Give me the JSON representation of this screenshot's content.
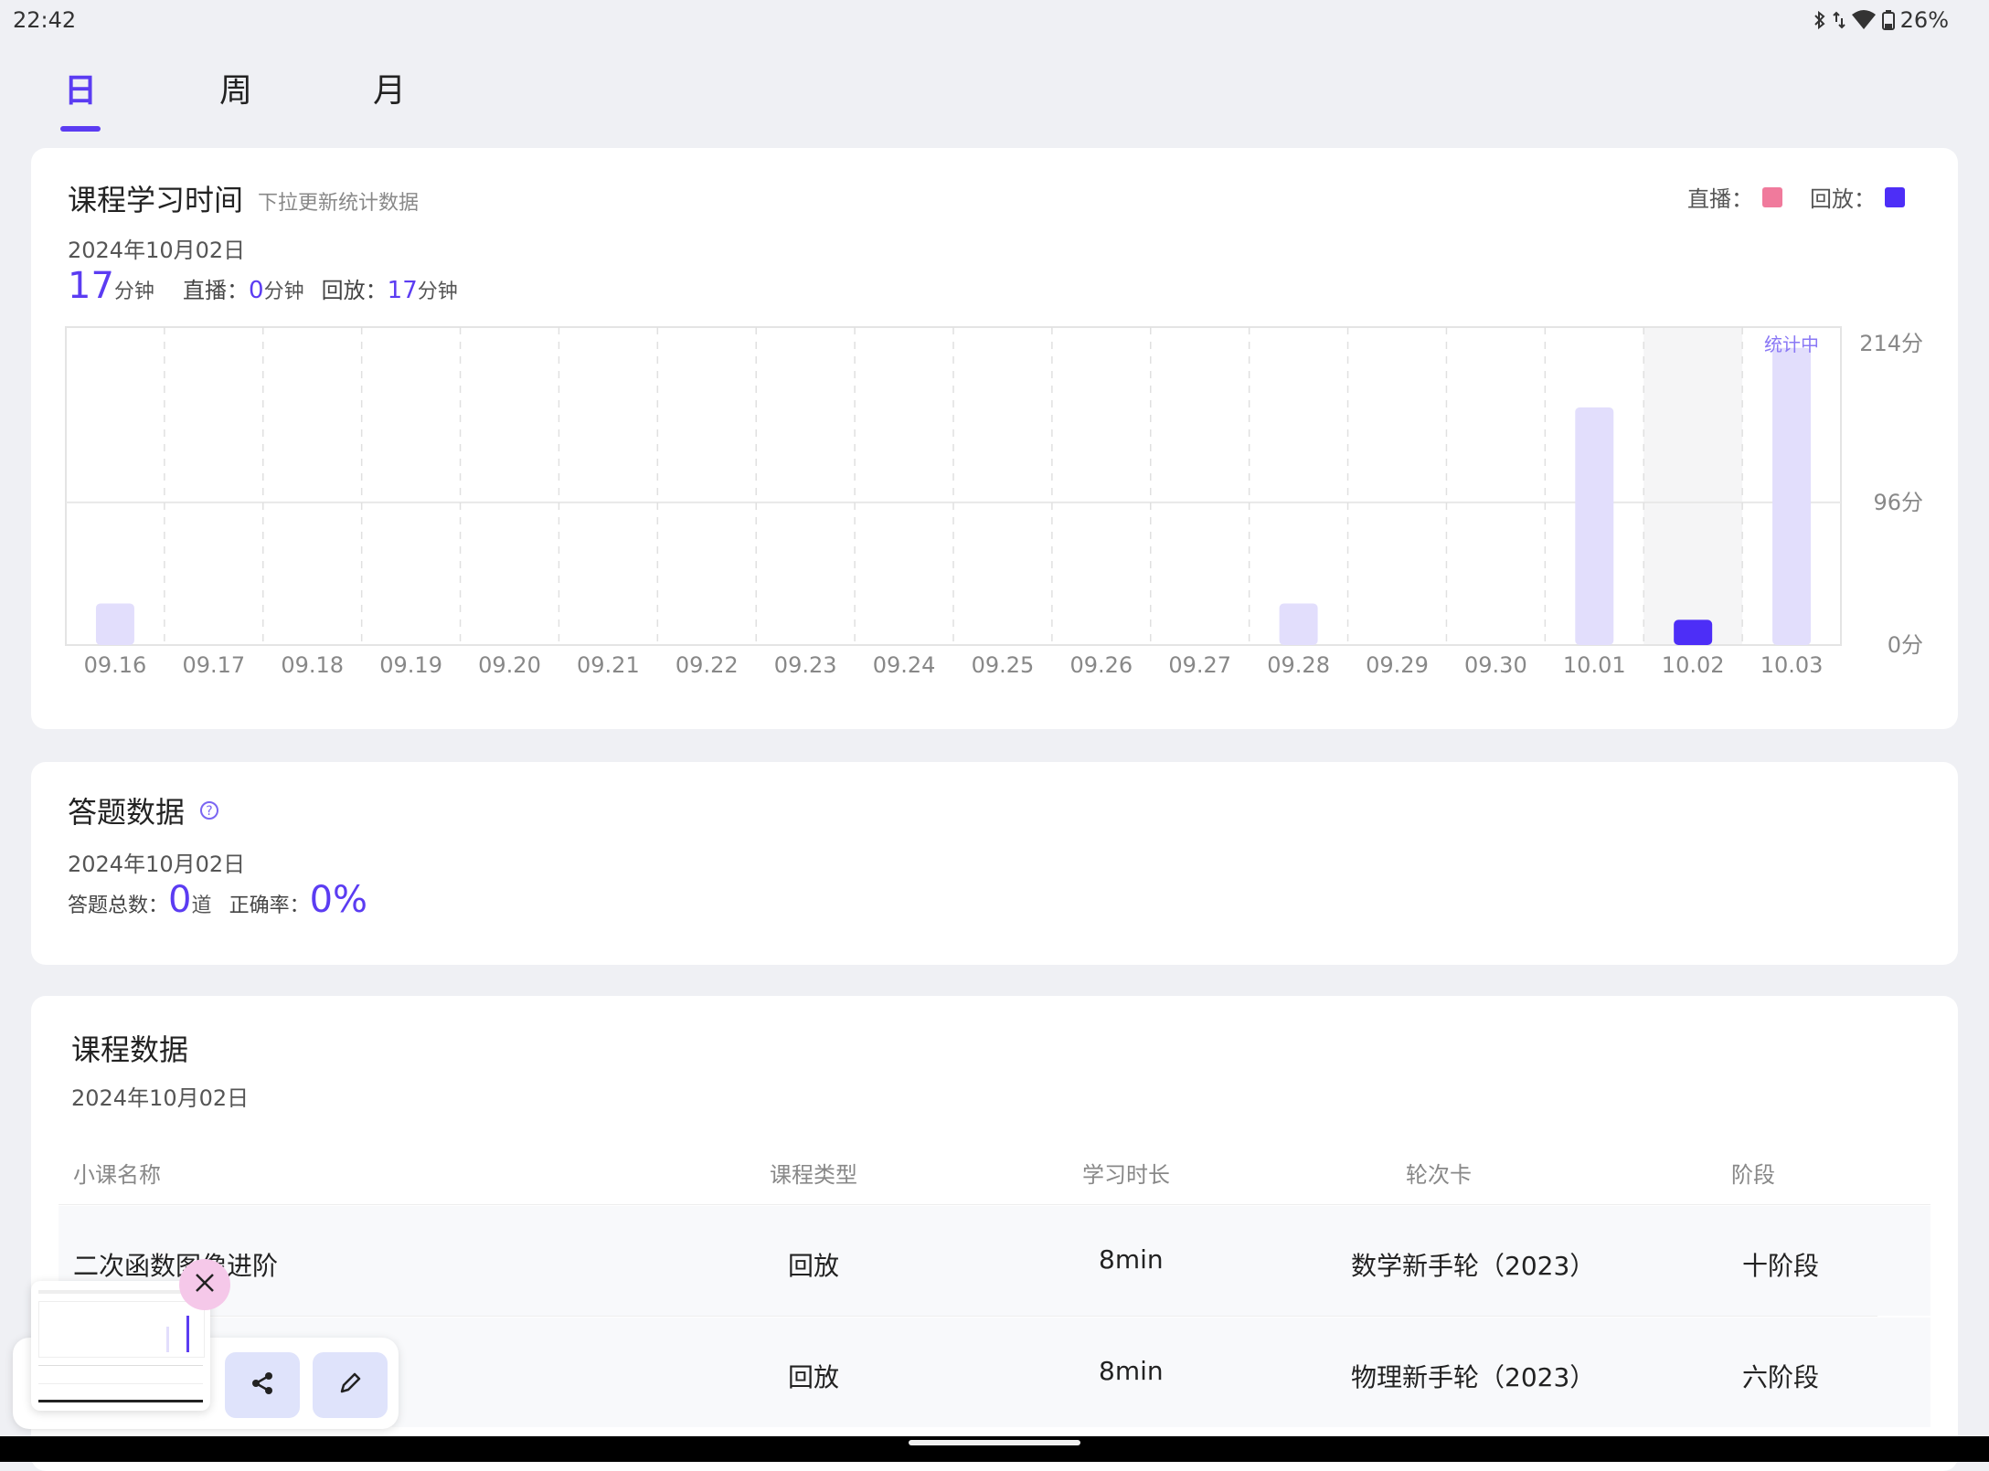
{
  "status": {
    "time": "22:42",
    "battery": "26%"
  },
  "tabs": [
    {
      "label": "日",
      "active": true
    },
    {
      "label": "周",
      "active": false
    },
    {
      "label": "月",
      "active": false
    }
  ],
  "study_time": {
    "title": "课程学习时间",
    "subtitle": "下拉更新统计数据",
    "date": "2024年10月02日",
    "total_value": "17",
    "total_unit": "分钟",
    "live_label": "直播：",
    "live_value": "0",
    "live_unit": "分钟",
    "replay_label": "回放：",
    "replay_value": "17",
    "replay_unit": "分钟",
    "legend_live": "直播：",
    "legend_replay": "回放：",
    "counting_label": "统计中"
  },
  "colors": {
    "accent": "#5b3cf2",
    "live": "#f07a9c",
    "replay": "#4d2ef7",
    "bar_light": "#e2defc"
  },
  "chart_data": {
    "type": "bar",
    "categories": [
      "09.16",
      "09.17",
      "09.18",
      "09.19",
      "09.20",
      "09.21",
      "09.22",
      "09.23",
      "09.24",
      "09.25",
      "09.26",
      "09.27",
      "09.28",
      "09.29",
      "09.30",
      "10.01",
      "10.02",
      "10.03"
    ],
    "values": [
      28,
      0,
      0,
      0,
      0,
      0,
      0,
      0,
      0,
      0,
      0,
      0,
      28,
      0,
      0,
      160,
      17,
      200
    ],
    "selected_index": 16,
    "counting_index": 17,
    "y_ticks": [
      "214分",
      "96分",
      "0分"
    ],
    "y_tick_values": [
      214,
      96,
      0
    ],
    "ylim": [
      0,
      214
    ],
    "grid": true
  },
  "answers": {
    "title": "答题数据",
    "date": "2024年10月02日",
    "total_label": "答题总数：",
    "total_value": "0",
    "total_unit": "道",
    "accuracy_label": "正确率：",
    "accuracy_value": "0%"
  },
  "courses": {
    "title": "课程数据",
    "date": "2024年10月02日",
    "headers": [
      "小课名称",
      "课程类型",
      "学习时长",
      "轮次卡",
      "阶段"
    ],
    "rows": [
      {
        "name": "二次函数图像进阶",
        "type": "回放",
        "duration": "8min",
        "round": "数学新手轮（2023）",
        "stage": "十阶段"
      },
      {
        "name": "",
        "type": "回放",
        "duration": "8min",
        "round": "物理新手轮（2023）",
        "stage": "六阶段"
      }
    ]
  },
  "icons": {
    "close": "close-icon",
    "share": "share-icon",
    "edit": "pencil-icon",
    "help": "help-circle-icon"
  }
}
